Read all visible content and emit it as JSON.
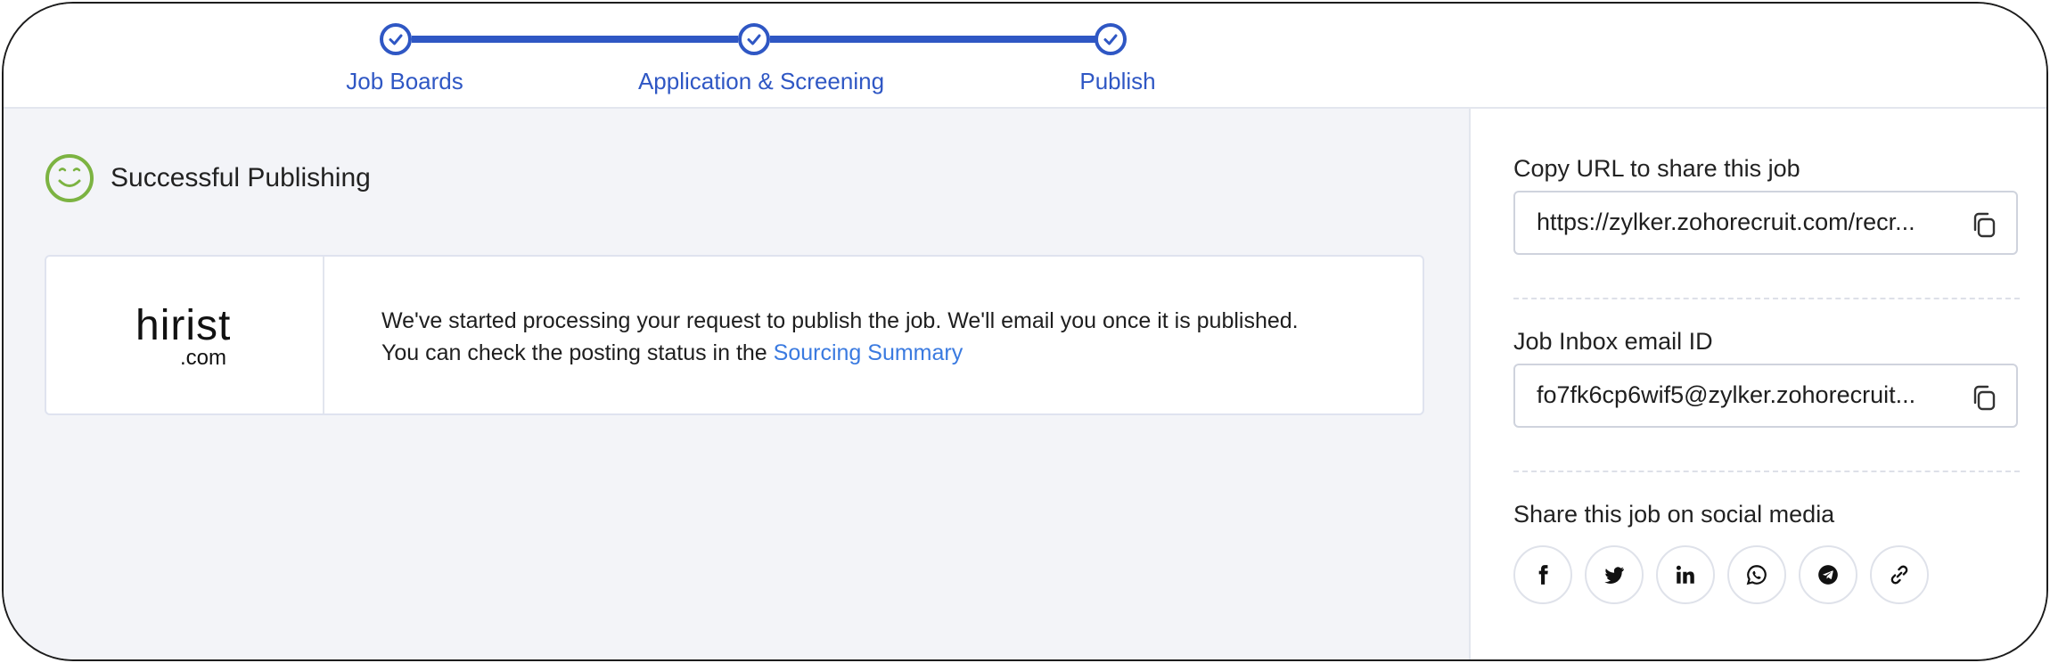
{
  "stepper": {
    "steps": [
      {
        "label": "Job Boards"
      },
      {
        "label": "Application & Screening"
      },
      {
        "label": "Publish"
      }
    ],
    "color": "#2f57c4"
  },
  "status": {
    "title": "Successful Publishing",
    "icon": "smiley-face-icon",
    "icon_color": "#7cb342"
  },
  "job_board": {
    "logo_main": "hirist",
    "logo_domain": ".com",
    "message": "We've started processing your request to publish the job. We'll email you once it is published. You can check the posting status in the ",
    "link_text": "Sourcing Summary"
  },
  "sidebar": {
    "share_url": {
      "label": "Copy URL to share this job",
      "value": "https://zylker.zohorecruit.com/recr..."
    },
    "inbox_email": {
      "label": "Job Inbox email ID",
      "value": "fo7fk6cp6wif5@zylker.zohorecruit..."
    },
    "social": {
      "label": "Share this job on social media",
      "buttons": [
        "facebook-icon",
        "twitter-icon",
        "linkedin-icon",
        "whatsapp-icon",
        "telegram-icon",
        "link-icon"
      ]
    }
  }
}
